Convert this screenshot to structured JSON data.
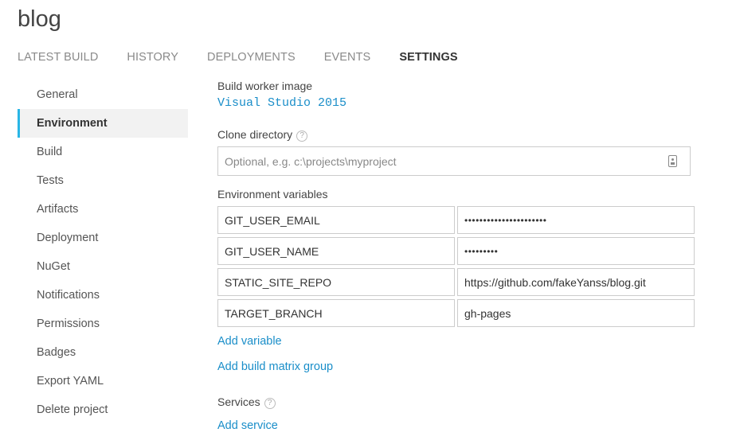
{
  "project": {
    "title": "blog"
  },
  "tabs": [
    {
      "label": "LATEST BUILD",
      "active": false
    },
    {
      "label": "HISTORY",
      "active": false
    },
    {
      "label": "DEPLOYMENTS",
      "active": false
    },
    {
      "label": "EVENTS",
      "active": false
    },
    {
      "label": "SETTINGS",
      "active": true
    }
  ],
  "sidebar": {
    "items": [
      {
        "label": "General"
      },
      {
        "label": "Environment",
        "active": true
      },
      {
        "label": "Build"
      },
      {
        "label": "Tests"
      },
      {
        "label": "Artifacts"
      },
      {
        "label": "Deployment"
      },
      {
        "label": "NuGet"
      },
      {
        "label": "Notifications"
      },
      {
        "label": "Permissions"
      },
      {
        "label": "Badges"
      },
      {
        "label": "Export YAML"
      },
      {
        "label": "Delete project"
      }
    ]
  },
  "settings": {
    "build_worker_image_label": "Build worker image",
    "build_worker_image_value": "Visual Studio 2015",
    "clone_directory_label": "Clone directory",
    "clone_directory_placeholder": "Optional, e.g. c:\\projects\\myproject",
    "clone_directory_value": "",
    "help_glyph": "?",
    "environment_variables_label": "Environment variables",
    "env_vars": [
      {
        "name": "GIT_USER_EMAIL",
        "value": "••••••••••••••••••••••",
        "secure": true
      },
      {
        "name": "GIT_USER_NAME",
        "value": "•••••••••",
        "secure": true
      },
      {
        "name": "STATIC_SITE_REPO",
        "value": "https://github.com/fakeYanss/blog.git",
        "secure": false
      },
      {
        "name": "TARGET_BRANCH",
        "value": "gh-pages",
        "secure": false
      }
    ],
    "add_variable_label": "Add variable",
    "add_build_matrix_group_label": "Add build matrix group",
    "services_label": "Services",
    "add_service_label": "Add service"
  },
  "colors": {
    "accent": "#29b6e6",
    "link": "#1a8ec9",
    "active_bg": "#f2f2f2"
  },
  "icons": {
    "clone_input_icon": "contact-card-icon",
    "help_icon": "help-circle-icon"
  }
}
